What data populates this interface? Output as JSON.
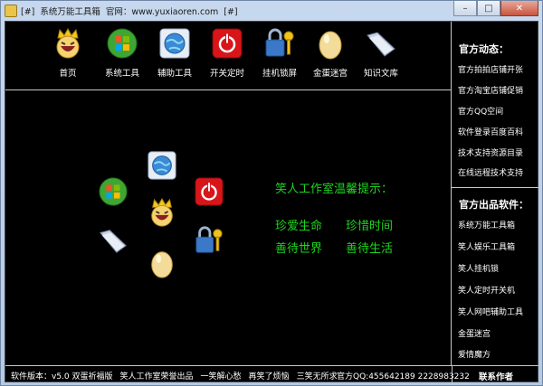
{
  "title": {
    "tag1": "[#]",
    "app_name": "系统万能工具箱",
    "site": "官网：www.yuxiaoren.com",
    "tag2": "[#]"
  },
  "window_buttons": {
    "minimize": "–",
    "maximize": "□",
    "close": "✕"
  },
  "toolbar": [
    {
      "label": "首页",
      "icon": "smiley-king-icon"
    },
    {
      "label": "系统工具",
      "icon": "windows-logo-icon"
    },
    {
      "label": "辅助工具",
      "icon": "globe-icon"
    },
    {
      "label": "开关定时",
      "icon": "power-icon"
    },
    {
      "label": "挂机锁屏",
      "icon": "lock-key-icon"
    },
    {
      "label": "金蛋迷宫",
      "icon": "golden-egg-icon"
    },
    {
      "label": "知识文库",
      "icon": "folder-icon"
    }
  ],
  "tip": {
    "title": "笑人工作室温馨提示：",
    "line1": [
      "珍爱生命",
      "珍惜时间"
    ],
    "line2": [
      "善待世界",
      "善待生活"
    ]
  },
  "sidebar": {
    "news_title": "官方动态：",
    "news": [
      "官方拍拍店铺开张",
      "官方淘宝店铺促销",
      "官方QQ空间",
      "软件登录百度百科",
      "技术支持资源目录",
      "在线远程技术支持"
    ],
    "products_title": "官方出品软件：",
    "products": [
      "系统万能工具箱",
      "笑人娱乐工具箱",
      "笑人挂机锁",
      "笑人定时开关机",
      "笑人网吧辅助工具",
      "金蛋迷宫",
      "爱情魔方"
    ]
  },
  "status": {
    "version": "软件版本：v5.0 双蛋祈福版",
    "studio": "笑人工作室荣誉出品",
    "motto1": "一笑解心愁",
    "motto2": "再笑了烦恼",
    "motto3": "三笑无所求",
    "qq": "官方QQ:455642189 2228983232",
    "contact": "联系作者"
  },
  "colors": {
    "background": "#000000",
    "tip_green": "#1ed41e",
    "divider": "#c8c8c8"
  }
}
